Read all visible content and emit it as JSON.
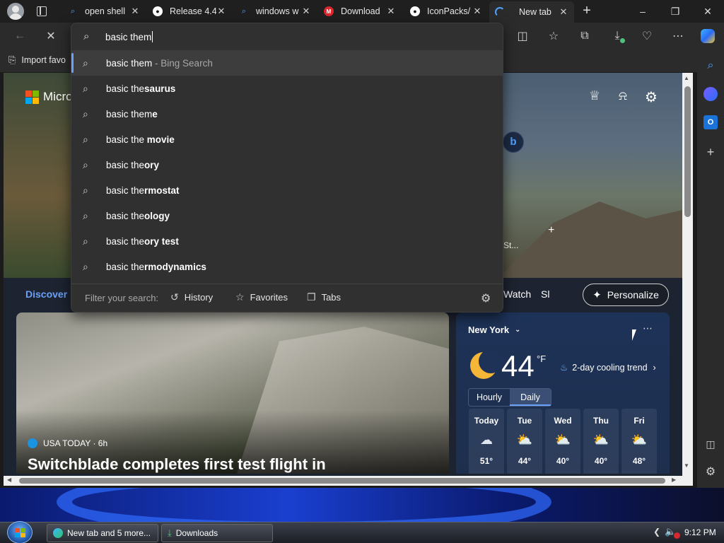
{
  "tabs": [
    {
      "label": "open shell",
      "icon": "bing-search-icon"
    },
    {
      "label": "Release 4.4",
      "icon": "github-icon"
    },
    {
      "label": "windows w",
      "icon": "bing-search-icon"
    },
    {
      "label": "Download",
      "icon": "mega-icon"
    },
    {
      "label": "IconPacks/",
      "icon": "github-icon"
    },
    {
      "label": "New tab",
      "icon": "edge-loading-icon"
    }
  ],
  "new_tab_symbol": "+",
  "favorites_bar": {
    "import_label": "Import favo"
  },
  "omnibox": {
    "query": "basic them",
    "suggestions": [
      {
        "prefix": "basic them",
        "bold": "",
        "suffix": " - Bing Search"
      },
      {
        "prefix": "basic the",
        "bold": "saurus",
        "suffix": ""
      },
      {
        "prefix": "basic them",
        "bold": "e",
        "suffix": ""
      },
      {
        "prefix": "basic the ",
        "bold": "movie",
        "suffix": ""
      },
      {
        "prefix": "basic the",
        "bold": "ory",
        "suffix": ""
      },
      {
        "prefix": "basic the",
        "bold": "rmostat",
        "suffix": ""
      },
      {
        "prefix": "basic the",
        "bold": "ology",
        "suffix": ""
      },
      {
        "prefix": "basic the",
        "bold": "ory test",
        "suffix": ""
      },
      {
        "prefix": "basic the",
        "bold": "rmodynamics",
        "suffix": ""
      }
    ],
    "filter_label": "Filter your search:",
    "filters": {
      "history": "History",
      "favorites": "Favorites",
      "tabs": "Tabs"
    }
  },
  "newtab": {
    "brand": "Micro",
    "discover_label": "Discover",
    "watch_label": "Watch",
    "s_label": "Sl",
    "image_caption": "St...",
    "personalize_label": "Personalize",
    "news": {
      "source": "USA TODAY · 6h",
      "headline": "Switchblade completes first test flight in"
    },
    "weather": {
      "location": "New York",
      "temp": "44",
      "unit": "°F",
      "trend": "2-day cooling trend",
      "tabs": {
        "hourly": "Hourly",
        "daily": "Daily"
      },
      "days": [
        {
          "name": "Today",
          "temp": "51°",
          "icon": "cloud-icon"
        },
        {
          "name": "Tue",
          "temp": "44°",
          "icon": "partly-sunny-icon"
        },
        {
          "name": "Wed",
          "temp": "40°",
          "icon": "partly-sunny-icon"
        },
        {
          "name": "Thu",
          "temp": "40°",
          "icon": "partly-sunny-icon"
        },
        {
          "name": "Fri",
          "temp": "48°",
          "icon": "partly-sunny-icon"
        }
      ]
    }
  },
  "taskbar": {
    "edge_task": "New tab and 5 more...",
    "downloads_task": "Downloads",
    "clock": "9:12 PM"
  }
}
